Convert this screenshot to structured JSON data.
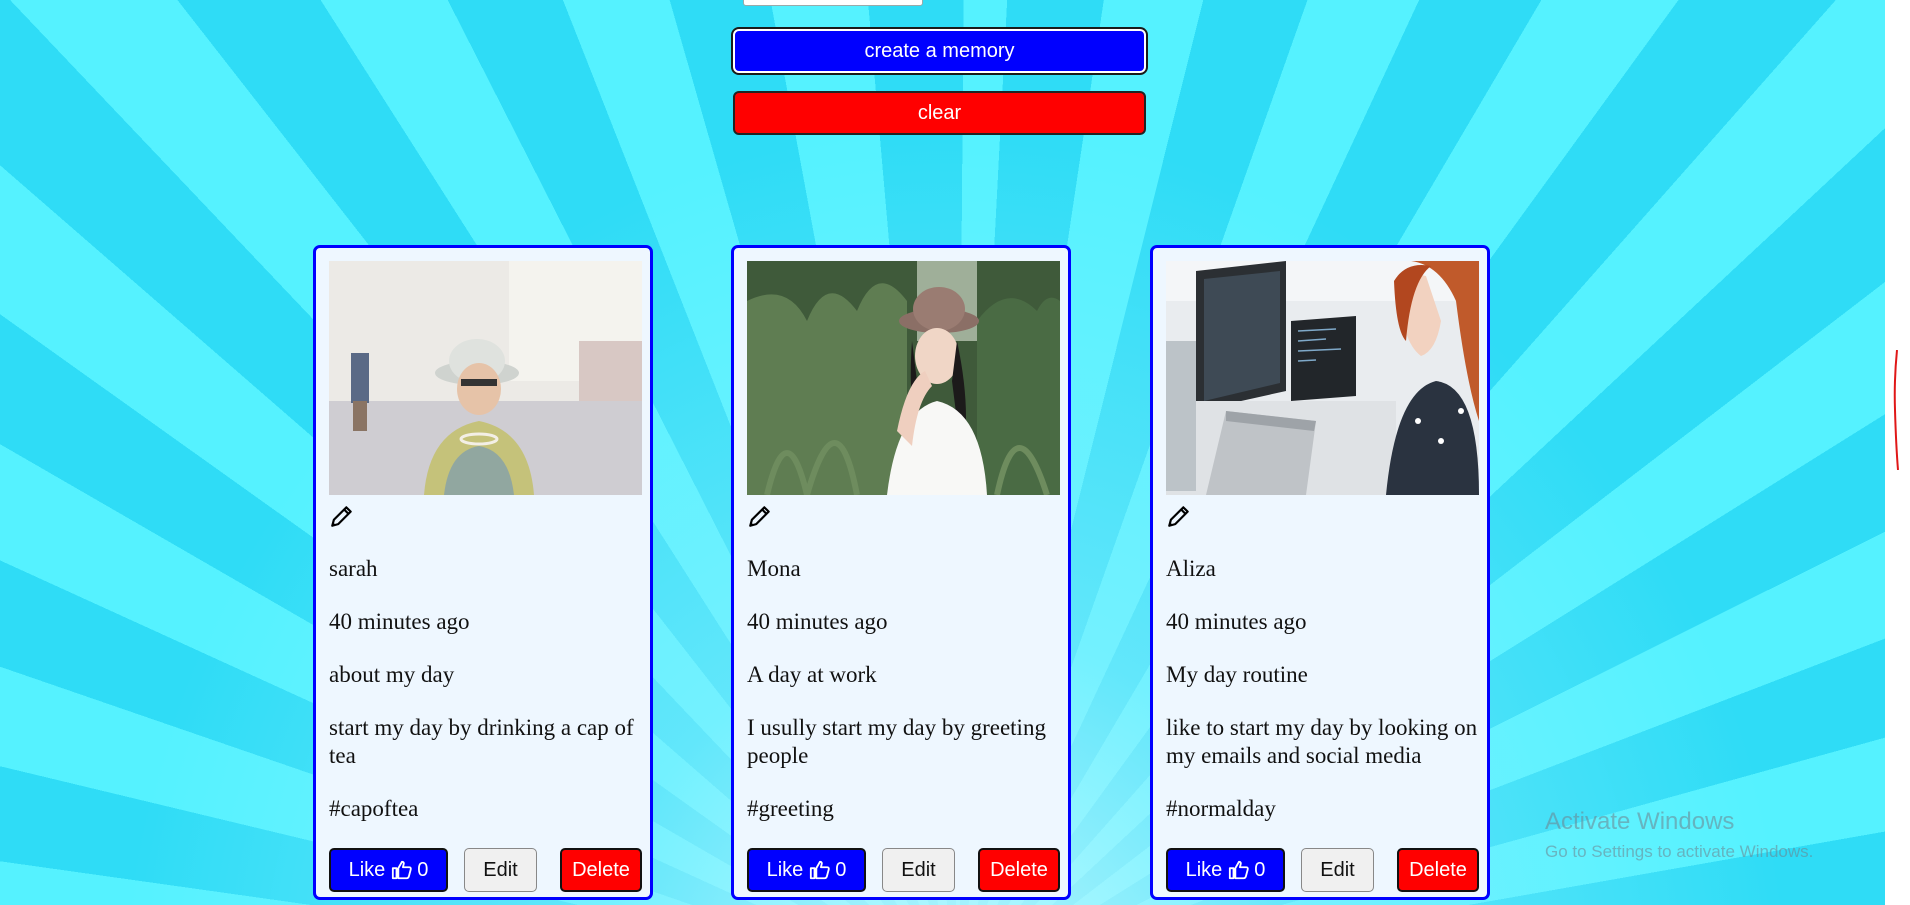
{
  "form": {
    "create_label": "create a memory",
    "clear_label": "clear"
  },
  "cards": [
    {
      "creator": "sarah",
      "time": "40 minutes ago",
      "title": "about my day",
      "message": "start my day by drinking a cap of tea",
      "tags": "#capoftea",
      "like_label": "Like",
      "like_count": "0",
      "edit_label": "Edit",
      "delete_label": "Delete"
    },
    {
      "creator": "Mona",
      "time": "40 minutes ago",
      "title": "A day at work",
      "message": "I usully start my day by greeting people",
      "tags": "#greeting",
      "like_label": "Like",
      "like_count": "0",
      "edit_label": "Edit",
      "delete_label": "Delete"
    },
    {
      "creator": "Aliza",
      "time": "40 minutes ago",
      "title": "My day routine",
      "message": "like to start my day by looking on my emails and social media",
      "tags": "#normalday",
      "like_label": "Like",
      "like_count": "0",
      "edit_label": "Edit",
      "delete_label": "Delete"
    }
  ],
  "watermark": {
    "line1": "Activate Windows",
    "line2": "Go to Settings to activate Windows."
  },
  "colors": {
    "accent_blue": "#0000ff",
    "danger_red": "#ff0000",
    "card_bg": "#eef7ff"
  },
  "icons": [
    "pencil-icon",
    "thumbs-up-icon"
  ]
}
